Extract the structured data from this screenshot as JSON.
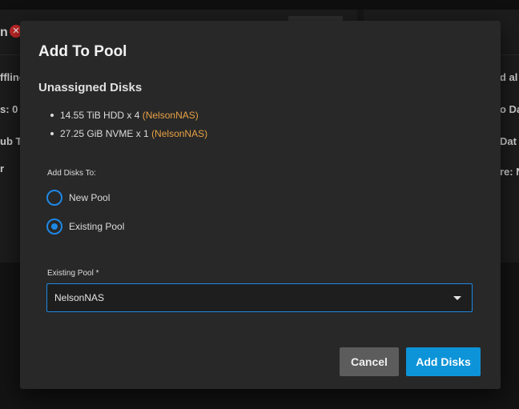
{
  "background": {
    "left_fragments": [
      "n",
      "ffline",
      "s: 0",
      "ub Ta",
      "r"
    ],
    "right_fragments": [
      "d al",
      "o Da",
      "Dat",
      "re: N"
    ]
  },
  "modal": {
    "title": "Add To Pool",
    "section_title": "Unassigned Disks",
    "disks": [
      {
        "text": "14.55 TiB HDD x 4",
        "pool": "(NelsonNAS)"
      },
      {
        "text": "27.25 GiB NVME x 1",
        "pool": "(NelsonNAS)"
      }
    ],
    "add_disks_to_label": "Add Disks To:",
    "options": [
      {
        "label": "New Pool",
        "selected": false
      },
      {
        "label": "Existing Pool",
        "selected": true
      }
    ],
    "existing_pool_label": "Existing Pool *",
    "existing_pool_value": "NelsonNAS",
    "cancel_label": "Cancel",
    "add_label": "Add Disks"
  },
  "colors": {
    "accent": "#1e88e5",
    "pool_tag": "#e8a245",
    "primary_button": "#0d94d8",
    "secondary_button": "#5c5c5c",
    "modal_bg": "#282828"
  }
}
